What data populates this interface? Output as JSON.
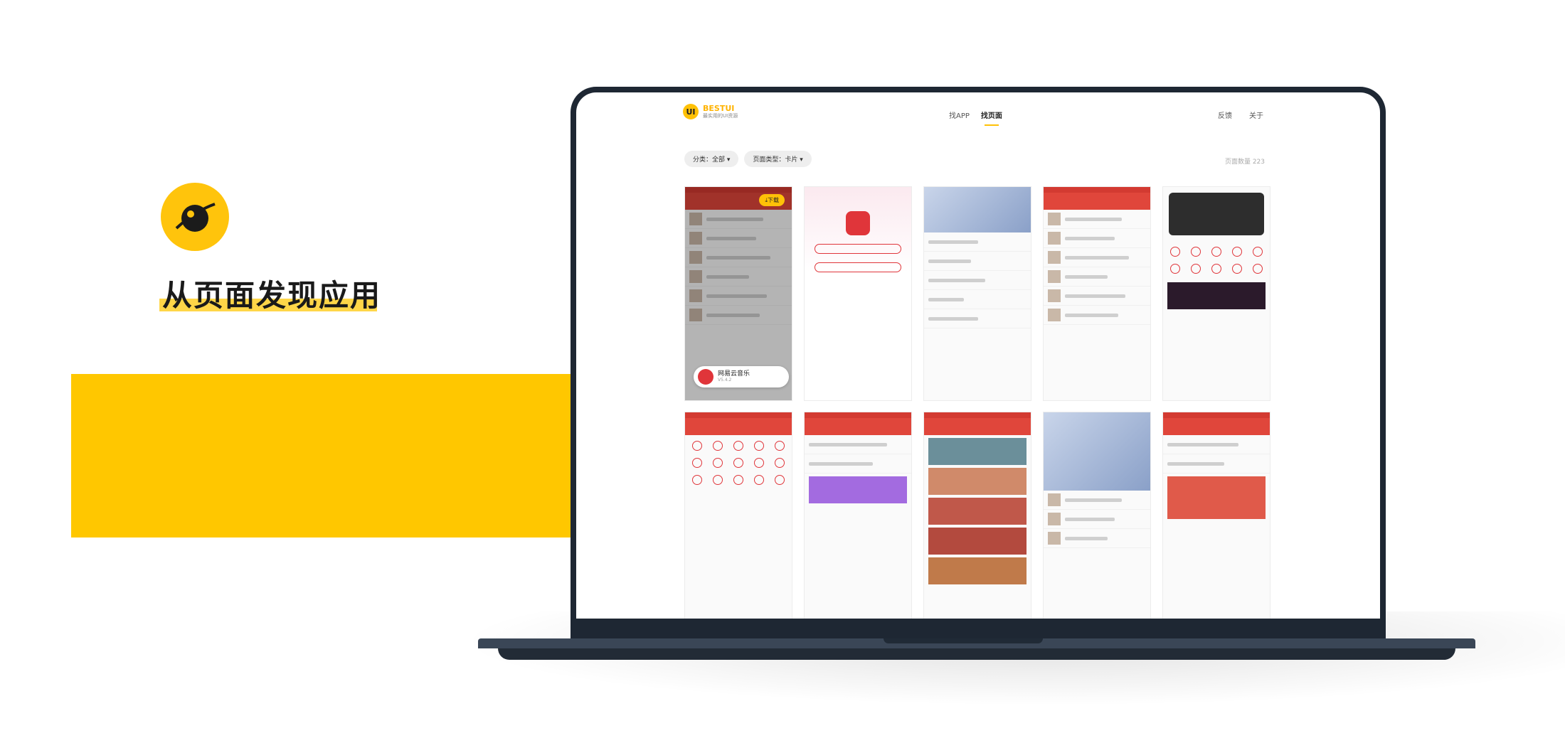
{
  "promo": {
    "headline": "从页面发现应用",
    "accent_color": "#ffc700"
  },
  "site": {
    "brand_badge": "UI",
    "brand_name": "BESTUI",
    "brand_sub": "最实用的UI资源",
    "nav": {
      "find_app": "找APP",
      "find_page": "找页面"
    },
    "right_links": {
      "feedback": "反馈",
      "about": "关于"
    },
    "filters": {
      "category": "分类：全部 ▾",
      "page_type": "页面类型：卡片 ▾"
    },
    "page_count": "页面数量 223"
  },
  "cards": [
    {
      "download_label": "⤓下载",
      "app_name": "网易云音乐",
      "app_version": "V5.4.2"
    }
  ]
}
